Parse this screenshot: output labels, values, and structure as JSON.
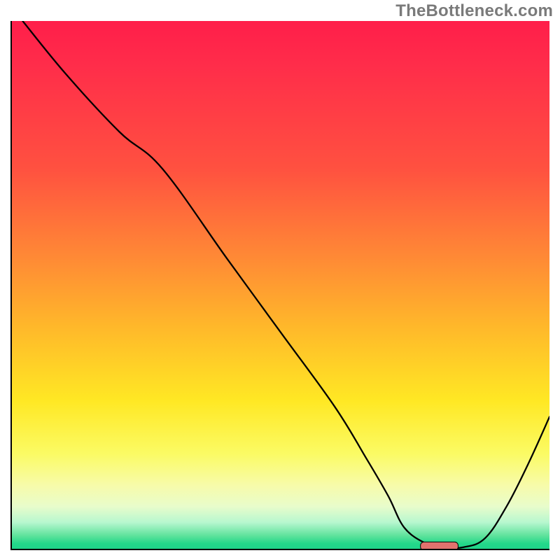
{
  "watermark": "TheBottleneck.com",
  "chart_data": {
    "type": "line",
    "title": "",
    "xlabel": "",
    "ylabel": "",
    "xlim": [
      0,
      100
    ],
    "ylim": [
      0,
      100
    ],
    "grid": false,
    "legend": false,
    "notes": "Axes have no tick labels; y-values are read as percent of plot height (0 at bottom, 100 at top). x-values are percent of plot width. The marker is a short pink rounded segment at the curve's minimum.",
    "series": [
      {
        "name": "curve",
        "x": [
          2,
          10,
          20,
          28,
          40,
          50,
          60,
          66,
          70,
          73,
          77,
          80,
          84,
          88,
          92,
          96,
          100
        ],
        "values": [
          100,
          90,
          79,
          72,
          55,
          41,
          27,
          17,
          10,
          4,
          1,
          0.3,
          0.3,
          2,
          8,
          16,
          25
        ]
      }
    ],
    "marker": {
      "name": "pink-min-marker",
      "x_start": 76,
      "x_end": 83,
      "y": 0.5,
      "color": "#e2726e"
    },
    "background_gradient": {
      "stops": [
        {
          "pct": 0,
          "color": "#ff1e4a"
        },
        {
          "pct": 28,
          "color": "#ff5140"
        },
        {
          "pct": 58,
          "color": "#ffb82a"
        },
        {
          "pct": 82,
          "color": "#fbfb64"
        },
        {
          "pct": 95,
          "color": "#b7f7cf"
        },
        {
          "pct": 100,
          "color": "#1fd489"
        }
      ]
    }
  }
}
